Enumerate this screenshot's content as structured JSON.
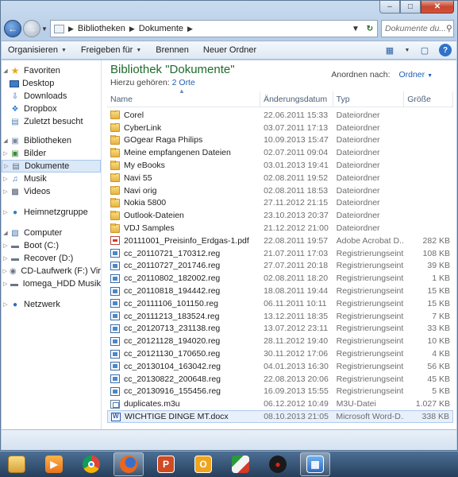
{
  "address": {
    "crumbs": [
      "Bibliotheken",
      "Dokumente"
    ],
    "search_placeholder": "Dokumente du..."
  },
  "toolbar": {
    "organize": "Organisieren",
    "share": "Freigeben für",
    "burn": "Brennen",
    "new_folder": "Neuer Ordner"
  },
  "nav": {
    "favorites": "Favoriten",
    "desktop": "Desktop",
    "downloads": "Downloads",
    "dropbox": "Dropbox",
    "recent": "Zuletzt besucht",
    "libraries": "Bibliotheken",
    "pictures": "Bilder",
    "documents": "Dokumente",
    "music": "Musik",
    "videos": "Videos",
    "homegroup": "Heimnetzgruppe",
    "computer": "Computer",
    "boot": "Boot (C:)",
    "recover": "Recover (D:)",
    "cd": "CD-Laufwerk (F:) Vir",
    "iomega": "Iomega_HDD Musik",
    "network": "Netzwerk"
  },
  "library": {
    "title": "Bibliothek \"Dokumente\"",
    "includes_label": "Hierzu gehören:",
    "includes_link": "2 Orte",
    "arrange_label": "Anordnen nach:",
    "arrange_value": "Ordner"
  },
  "columns": {
    "name": "Name",
    "date": "Änderungsdatum",
    "type": "Typ",
    "size": "Größe"
  },
  "files": [
    {
      "icon": "folder",
      "name": "Corel",
      "date": "22.06.2011 15:33",
      "type": "Dateiordner",
      "size": ""
    },
    {
      "icon": "folder",
      "name": "CyberLink",
      "date": "03.07.2011 17:13",
      "type": "Dateiordner",
      "size": ""
    },
    {
      "icon": "folder",
      "name": "GOgear Raga Philips",
      "date": "10.09.2013 15:47",
      "type": "Dateiordner",
      "size": ""
    },
    {
      "icon": "folder",
      "name": "Meine empfangenen Dateien",
      "date": "02.07.2011 09:04",
      "type": "Dateiordner",
      "size": ""
    },
    {
      "icon": "folder",
      "name": "My eBooks",
      "date": "03.01.2013 19:41",
      "type": "Dateiordner",
      "size": ""
    },
    {
      "icon": "folder",
      "name": "Navi 55",
      "date": "02.08.2011 19:52",
      "type": "Dateiordner",
      "size": ""
    },
    {
      "icon": "folder",
      "name": "Navi orig",
      "date": "02.08.2011 18:53",
      "type": "Dateiordner",
      "size": ""
    },
    {
      "icon": "folder",
      "name": "Nokia 5800",
      "date": "27.11.2012 21:15",
      "type": "Dateiordner",
      "size": ""
    },
    {
      "icon": "folder",
      "name": "Outlook-Dateien",
      "date": "23.10.2013 20:37",
      "type": "Dateiordner",
      "size": ""
    },
    {
      "icon": "folder",
      "name": "VDJ Samples",
      "date": "21.12.2012 21:00",
      "type": "Dateiordner",
      "size": ""
    },
    {
      "icon": "pdf",
      "name": "20111001_Preisinfo_Erdgas-1.pdf",
      "date": "22.08.2011 19:57",
      "type": "Adobe Acrobat D...",
      "size": "282 KB"
    },
    {
      "icon": "reg",
      "name": "cc_20110721_170312.reg",
      "date": "21.07.2011 17:03",
      "type": "Registrierungseint...",
      "size": "108 KB"
    },
    {
      "icon": "reg",
      "name": "cc_20110727_201746.reg",
      "date": "27.07.2011 20:18",
      "type": "Registrierungseint...",
      "size": "39 KB"
    },
    {
      "icon": "reg",
      "name": "cc_20110802_182002.reg",
      "date": "02.08.2011 18:20",
      "type": "Registrierungseint...",
      "size": "1 KB"
    },
    {
      "icon": "reg",
      "name": "cc_20110818_194442.reg",
      "date": "18.08.2011 19:44",
      "type": "Registrierungseint...",
      "size": "15 KB"
    },
    {
      "icon": "reg",
      "name": "cc_20111106_101150.reg",
      "date": "06.11.2011 10:11",
      "type": "Registrierungseint...",
      "size": "15 KB"
    },
    {
      "icon": "reg",
      "name": "cc_20111213_183524.reg",
      "date": "13.12.2011 18:35",
      "type": "Registrierungseint...",
      "size": "7 KB"
    },
    {
      "icon": "reg",
      "name": "cc_20120713_231138.reg",
      "date": "13.07.2012 23:11",
      "type": "Registrierungseint...",
      "size": "33 KB"
    },
    {
      "icon": "reg",
      "name": "cc_20121128_194020.reg",
      "date": "28.11.2012 19:40",
      "type": "Registrierungseint...",
      "size": "10 KB"
    },
    {
      "icon": "reg",
      "name": "cc_20121130_170650.reg",
      "date": "30.11.2012 17:06",
      "type": "Registrierungseint...",
      "size": "4 KB"
    },
    {
      "icon": "reg",
      "name": "cc_20130104_163042.reg",
      "date": "04.01.2013 16:30",
      "type": "Registrierungseint...",
      "size": "56 KB"
    },
    {
      "icon": "reg",
      "name": "cc_20130822_200648.reg",
      "date": "22.08.2013 20:06",
      "type": "Registrierungseint...",
      "size": "45 KB"
    },
    {
      "icon": "reg",
      "name": "cc_20130916_155456.reg",
      "date": "16.09.2013 15:55",
      "type": "Registrierungseint...",
      "size": "5 KB"
    },
    {
      "icon": "m3u",
      "name": "duplicates.m3u",
      "date": "06.12.2012 10:49",
      "type": "M3U-Datei",
      "size": "1.027 KB"
    },
    {
      "icon": "docx",
      "name": "WICHTIGE DINGE MT.docx",
      "date": "08.10.2013 21:05",
      "type": "Microsoft Word-D...",
      "size": "338 KB"
    }
  ],
  "taskbar": [
    "file-explorer",
    "media-player",
    "chrome",
    "firefox",
    "powerpoint",
    "outlook",
    "app-triangle",
    "app-dark",
    "app-blue"
  ]
}
